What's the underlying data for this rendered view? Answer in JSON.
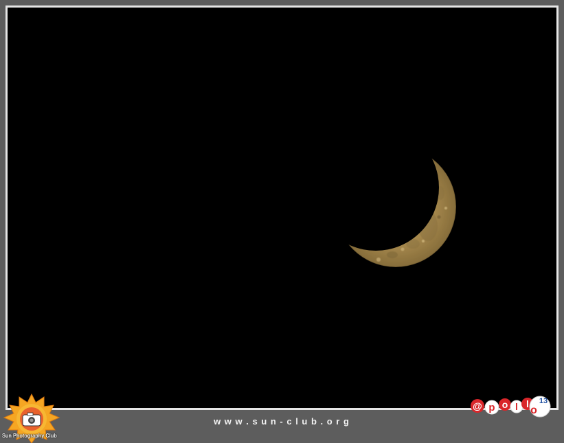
{
  "image": {
    "subject": "crescent-moon",
    "background_color": "#000000",
    "moon_color": "#a88a4e",
    "frame_color": "#5d5d5d"
  },
  "watermark": {
    "website": "w w w . s u n - c l u b . o r g",
    "club_name": "Sun Photography Club",
    "logo_badge": "SPC",
    "author_tag_text": "@pollo",
    "author_tag_number": "13"
  }
}
